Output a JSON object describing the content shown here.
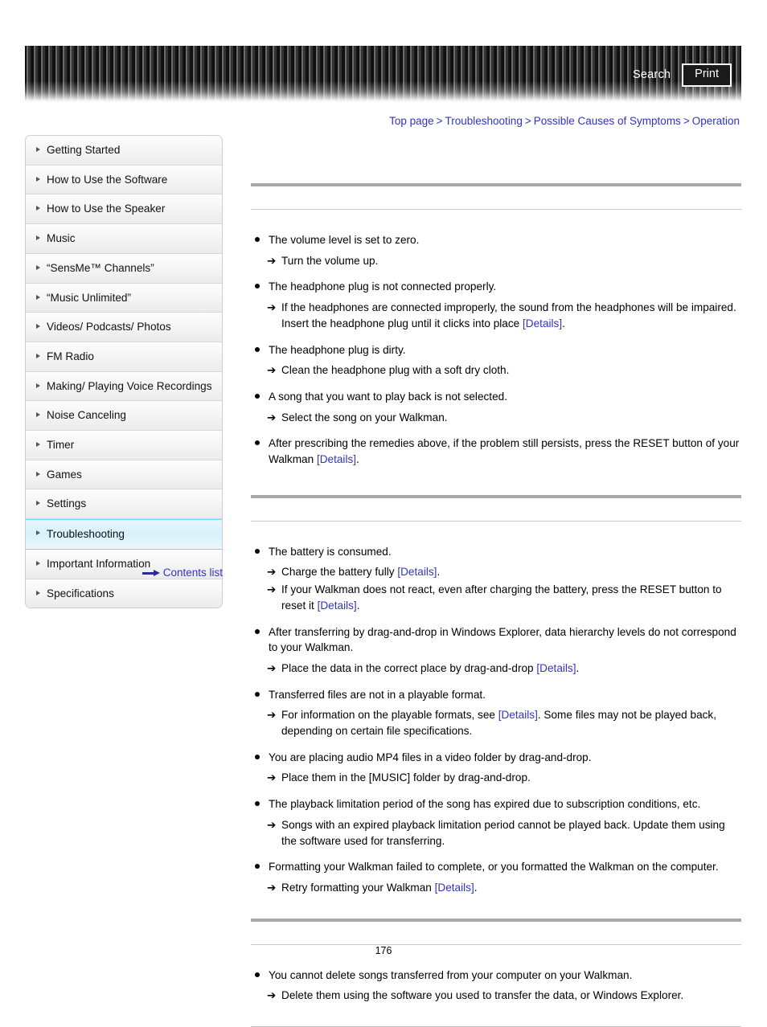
{
  "header": {
    "search_label": "Search",
    "print_label": "Print"
  },
  "breadcrumb": {
    "separator": ">",
    "items": [
      {
        "label": "Top page"
      },
      {
        "label": "Troubleshooting"
      },
      {
        "label": "Possible Causes of Symptoms"
      },
      {
        "label": "Operation"
      }
    ]
  },
  "sidebar": {
    "items": [
      {
        "label": "Getting Started",
        "active": false
      },
      {
        "label": "How to Use the Software",
        "active": false
      },
      {
        "label": "How to Use the Speaker",
        "active": false
      },
      {
        "label": "Music",
        "active": false
      },
      {
        "label": "“SensMe™ Channels”",
        "active": false
      },
      {
        "label": "“Music Unlimited”",
        "active": false
      },
      {
        "label": "Videos/ Podcasts/ Photos",
        "active": false
      },
      {
        "label": "FM Radio",
        "active": false
      },
      {
        "label": "Making/ Playing Voice Recordings",
        "active": false
      },
      {
        "label": "Noise Canceling",
        "active": false
      },
      {
        "label": "Timer",
        "active": false
      },
      {
        "label": "Games",
        "active": false
      },
      {
        "label": "Settings",
        "active": false
      },
      {
        "label": "Troubleshooting",
        "active": true
      },
      {
        "label": "Important Information",
        "active": false
      },
      {
        "label": "Specifications",
        "active": false
      }
    ],
    "contents_list_label": "Contents list"
  },
  "main": {
    "sections": [
      {
        "heading": "",
        "groups": [
          {
            "cause": "The volume level is set to zero.",
            "remedies": [
              {
                "text_before": "Turn the volume up.",
                "link": "",
                "text_after": ""
              }
            ]
          },
          {
            "cause": "The headphone plug is not connected properly.",
            "remedies": [
              {
                "text_before": "If the headphones are connected improperly, the sound from the headphones will be impaired. Insert the headphone plug until it clicks into place ",
                "link": "[Details]",
                "text_after": "."
              }
            ]
          },
          {
            "cause": "The headphone plug is dirty.",
            "remedies": [
              {
                "text_before": "Clean the headphone plug with a soft dry cloth.",
                "link": "",
                "text_after": ""
              }
            ]
          },
          {
            "cause": "A song that you want to play back is not selected.",
            "remedies": [
              {
                "text_before": "Select the song on your Walkman.",
                "link": "",
                "text_after": ""
              }
            ]
          },
          {
            "cause_before": "After prescribing the remedies above, if the problem still persists, press the RESET button of your Walkman ",
            "cause_link": "[Details]",
            "cause_after": ".",
            "remedies": []
          }
        ]
      },
      {
        "heading": "",
        "groups": [
          {
            "cause": "The battery is consumed.",
            "remedies": [
              {
                "text_before": "Charge the battery fully ",
                "link": "[Details]",
                "text_after": "."
              },
              {
                "text_before": "If your Walkman does not react, even after charging the battery, press the RESET button to reset it ",
                "link": "[Details]",
                "text_after": "."
              }
            ]
          },
          {
            "cause": "After transferring by drag-and-drop in Windows Explorer, data hierarchy levels do not correspond to your Walkman.",
            "remedies": [
              {
                "text_before": "Place the data in the correct place by drag-and-drop ",
                "link": "[Details]",
                "text_after": "."
              }
            ]
          },
          {
            "cause": "Transferred files are not in a playable format.",
            "remedies": [
              {
                "text_before": "For information on the playable formats, see ",
                "link": "[Details]",
                "text_after": ". Some files may not be played back, depending on certain file specifications."
              }
            ]
          },
          {
            "cause": "You are placing audio MP4 files in a video folder by drag-and-drop.",
            "remedies": [
              {
                "text_before": "Place them in the [MUSIC] folder by drag-and-drop.",
                "link": "",
                "text_after": ""
              }
            ]
          },
          {
            "cause": "The playback limitation period of the song has expired due to subscription conditions, etc.",
            "remedies": [
              {
                "text_before": "Songs with an expired playback limitation period cannot be played back. Update them using the software used for transferring.",
                "link": "",
                "text_after": ""
              }
            ]
          },
          {
            "cause": "Formatting your Walkman failed to complete, or you formatted the Walkman on the computer.",
            "remedies": [
              {
                "text_before": "Retry formatting your Walkman ",
                "link": "[Details]",
                "text_after": "."
              }
            ]
          }
        ]
      },
      {
        "heading": "",
        "groups": [
          {
            "cause": "You cannot delete songs transferred from your computer on your Walkman.",
            "remedies": [
              {
                "text_before": "Delete them using the software you used to transfer the data, or Windows Explorer.",
                "link": "",
                "text_after": ""
              }
            ]
          }
        ]
      }
    ]
  },
  "footer": {
    "page_number": "176"
  },
  "colors": {
    "link": "#3333bb",
    "active_item_bg": "#d7f1fb",
    "active_item_border": "#79d6ef",
    "rule_thick": "#a9a9a9",
    "rule_thin": "#c9c9c9"
  }
}
